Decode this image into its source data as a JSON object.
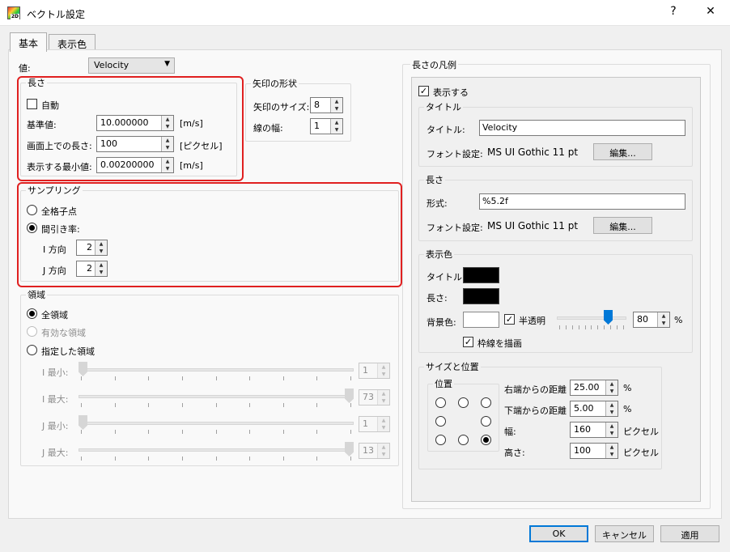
{
  "window": {
    "title": "ベクトル設定",
    "help": "?",
    "close": "✕"
  },
  "tabs": [
    "基本",
    "表示色"
  ],
  "value": {
    "label": "値:",
    "selected": "Velocity"
  },
  "length": {
    "title": "長さ",
    "auto_label": "自動",
    "auto_checked": false,
    "rows": [
      {
        "label": "基準値:",
        "value": "10.000000",
        "unit": "[m/s]"
      },
      {
        "label": "画面上での長さ:",
        "value": "100",
        "unit": "[ピクセル]"
      },
      {
        "label": "表示する最小値:",
        "value": "0.00200000",
        "unit": "[m/s]"
      }
    ]
  },
  "arrow_shape": {
    "title": "矢印の形状",
    "size_label": "矢印のサイズ:",
    "size_value": "8",
    "width_label": "線の幅:",
    "width_value": "1"
  },
  "sampling": {
    "title": "サンプリング",
    "all_label": "全格子点",
    "thin_label": "間引き率:",
    "selected": "thin",
    "i_label": "I 方向",
    "i_value": "2",
    "j_label": "J 方向",
    "j_value": "2"
  },
  "region": {
    "title": "領域",
    "opt_all": "全領域",
    "opt_valid": "有効な領域",
    "opt_spec": "指定した領域",
    "selected": "all",
    "sliders": [
      {
        "label": "I 最小:",
        "value": "1",
        "level": 0.0
      },
      {
        "label": "I 最大:",
        "value": "73",
        "level": 1.0
      },
      {
        "label": "J 最小:",
        "value": "1",
        "level": 0.0
      },
      {
        "label": "J 最大:",
        "value": "13",
        "level": 1.0
      }
    ]
  },
  "legend": {
    "title": "長さの凡例",
    "show_label": "表示する",
    "show_checked": true,
    "title_group": {
      "group": "タイトル",
      "title_label": "タイトル:",
      "title_value": "Velocity",
      "font_label": "フォント設定:",
      "font_value": "MS  UI Gothic 11  pt",
      "edit": "編集..."
    },
    "length_group": {
      "group": "長さ",
      "format_label": "形式:",
      "format_value": "%5.2f",
      "font_label": "フォント設定:",
      "font_value": "MS  UI Gothic 11  pt",
      "edit": "編集..."
    },
    "colors": {
      "group": "表示色",
      "title_label": "タイトル:",
      "title_color": "#000000",
      "length_label": "長さ:",
      "length_color": "#000000",
      "bg_label": "背景色:",
      "bg_color": "#ffffff",
      "translucent_label": "半透明",
      "translucent_checked": true,
      "opacity_value": "80",
      "opacity_level": 0.8,
      "percent": "%",
      "border_label": "枠線を描画",
      "border_checked": true
    },
    "size_pos": {
      "group": "サイズと位置",
      "pos_group": "位置",
      "selected_position": "bottom-right",
      "rows": [
        {
          "label": "右端からの距離",
          "value": "25.00",
          "unit": "%"
        },
        {
          "label": "下端からの距離",
          "value": "5.00",
          "unit": "%"
        },
        {
          "label": "幅:",
          "value": "160",
          "unit": "ピクセル"
        },
        {
          "label": "高さ:",
          "value": "100",
          "unit": "ピクセル"
        }
      ]
    }
  },
  "buttons": {
    "ok": "OK",
    "cancel": "キャンセル",
    "apply": "適用"
  }
}
